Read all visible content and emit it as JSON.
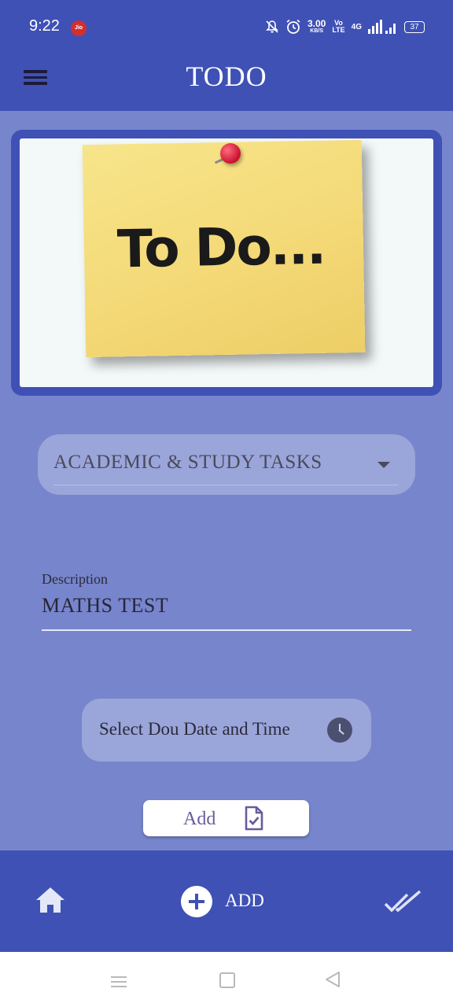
{
  "status_bar": {
    "time": "9:22",
    "carrier_badge": "Jio",
    "speed_value": "3.00",
    "speed_unit": "KB/S",
    "volte_top": "Vo",
    "volte_bottom": "LTE",
    "network": "4G",
    "battery": "37",
    "icons": [
      "bell-off-icon",
      "alarm-icon",
      "signal-icon",
      "battery-icon"
    ]
  },
  "app_bar": {
    "title": "TODO",
    "menu_icon": "hamburger-menu-icon"
  },
  "banner": {
    "image_text": "To Do..."
  },
  "form": {
    "category_selected": "ACADEMIC & STUDY TASKS",
    "description_label": "Description",
    "description_value": "MATHS TEST",
    "date_button_label": "Select Dou Date and Time",
    "add_button_label": "Add"
  },
  "bottom_nav": {
    "home_icon": "home-icon",
    "add_label": "ADD",
    "done_icon": "double-check-icon"
  },
  "colors": {
    "primary": "#3f51b5",
    "background": "#7785cc",
    "field_bg": "#9aa5da",
    "accent_text": "#6a5b9c"
  }
}
